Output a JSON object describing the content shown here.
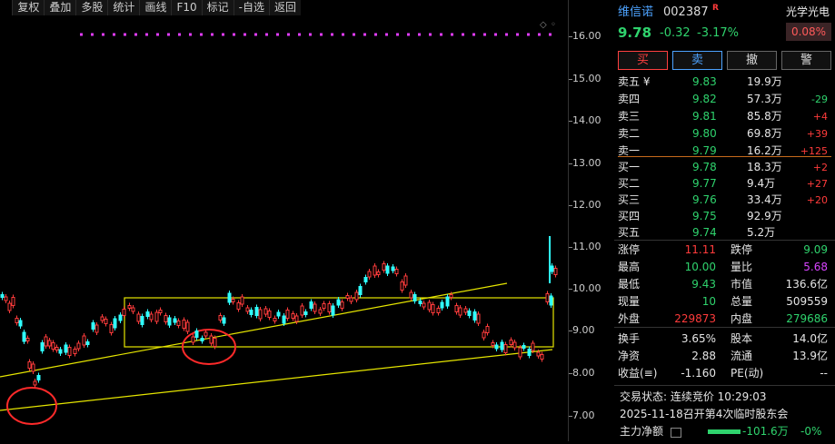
{
  "toolbar": {
    "items": [
      "复权",
      "叠加",
      "多股",
      "统计",
      "画线",
      "F10",
      "标记",
      "-自选",
      "返回"
    ]
  },
  "yaxis": {
    "ticks": [
      "16.00",
      "15.00",
      "14.00",
      "13.00",
      "12.00",
      "11.00",
      "10.00",
      "9.00",
      "8.00",
      "7.00"
    ]
  },
  "stock": {
    "name": "维信诺",
    "code": "002387",
    "flag": "R",
    "price": "9.78",
    "change": "-0.32",
    "pct": "-3.17%",
    "sector": "光学光电",
    "sector_pct": "0.08%"
  },
  "buttons": {
    "buy": "买",
    "sell": "卖",
    "cancel": "撤",
    "alert": "警"
  },
  "asks": [
    {
      "label": "卖五 ¥",
      "price": "9.83",
      "vol": "19.9万",
      "delta": ""
    },
    {
      "label": "卖四",
      "price": "9.82",
      "vol": "57.3万",
      "delta": "-29"
    },
    {
      "label": "卖三",
      "price": "9.81",
      "vol": "85.8万",
      "delta": "+4"
    },
    {
      "label": "卖二",
      "price": "9.80",
      "vol": "69.8万",
      "delta": "+39"
    },
    {
      "label": "卖一",
      "price": "9.79",
      "vol": "16.2万",
      "delta": "+125"
    }
  ],
  "bids": [
    {
      "label": "买一",
      "price": "9.78",
      "vol": "18.3万",
      "delta": "+2"
    },
    {
      "label": "买二",
      "price": "9.77",
      "vol": "9.4万",
      "delta": "+27"
    },
    {
      "label": "买三",
      "price": "9.76",
      "vol": "33.4万",
      "delta": "+20"
    },
    {
      "label": "买四",
      "price": "9.75",
      "vol": "92.9万",
      "delta": ""
    },
    {
      "label": "买五",
      "price": "9.74",
      "vol": "5.2万",
      "delta": ""
    }
  ],
  "stats": [
    {
      "l1": "涨停",
      "v1": "11.11",
      "c1": "up",
      "l2": "跌停",
      "v2": "9.09",
      "c2": "dn"
    },
    {
      "l1": "最高",
      "v1": "10.00",
      "c1": "dn",
      "l2": "量比",
      "v2": "5.68",
      "c2": "mg"
    },
    {
      "l1": "最低",
      "v1": "9.43",
      "c1": "dn",
      "l2": "市值",
      "v2": "136.6亿",
      "c2": "wh"
    },
    {
      "l1": "现量",
      "v1": "10",
      "c1": "dn",
      "l2": "总量",
      "v2": "509559",
      "c2": "wh"
    },
    {
      "l1": "外盘",
      "v1": "229873",
      "c1": "up",
      "l2": "内盘",
      "v2": "279686",
      "c2": "dn"
    }
  ],
  "fund": [
    {
      "l1": "换手",
      "v1": "3.65%",
      "l2": "股本",
      "v2": "14.0亿"
    },
    {
      "l1": "净资",
      "v1": "2.88",
      "l2": "流通",
      "v2": "13.9亿"
    },
    {
      "l1": "收益(≡)",
      "v1": "-1.160",
      "l2": "PE(动)",
      "v2": "--"
    }
  ],
  "status": "交易状态: 连续竞价 10:29:03",
  "notice": "2025-11-18召开第4次临时股东会",
  "mainflow": {
    "label": "主力净额",
    "value": "-101.6万",
    "pct": "-0%"
  }
}
